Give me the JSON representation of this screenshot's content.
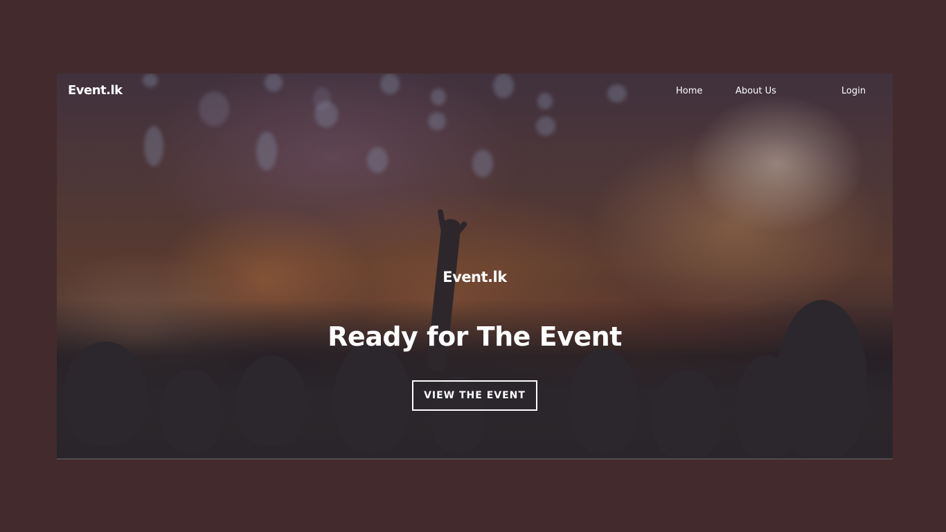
{
  "navbar": {
    "brand": "Event.lk",
    "links": [
      {
        "label": "Home"
      },
      {
        "label": "About Us"
      },
      {
        "label": "Login"
      }
    ]
  },
  "hero": {
    "brand": "Event.lk",
    "title": "Ready for The Event",
    "cta_label": "VIEW THE EVENT",
    "background_image": "concert-crowd-photo"
  },
  "colors": {
    "page_background": "#432b2d",
    "text": "#ffffff"
  }
}
